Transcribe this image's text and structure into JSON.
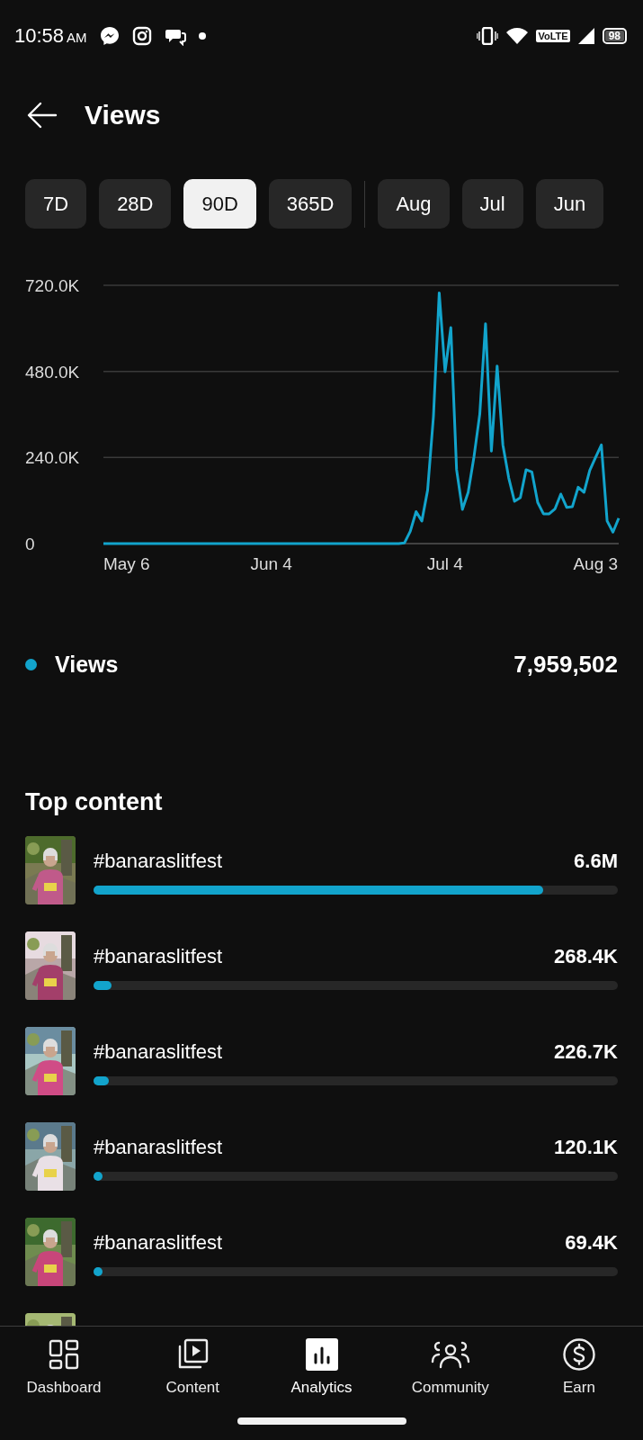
{
  "status_bar": {
    "time": "10:58",
    "ampm": "AM",
    "network": "VoLTE",
    "battery": "98"
  },
  "header": {
    "title": "Views"
  },
  "ranges": [
    {
      "label": "7D",
      "selected": false
    },
    {
      "label": "28D",
      "selected": false
    },
    {
      "label": "90D",
      "selected": true
    },
    {
      "label": "365D",
      "selected": false
    }
  ],
  "months": [
    {
      "label": "Aug",
      "selected": false
    },
    {
      "label": "Jul",
      "selected": false
    },
    {
      "label": "Jun",
      "selected": false
    }
  ],
  "chart_data": {
    "type": "line",
    "categories": [
      null,
      null,
      null,
      null,
      "May 6",
      null,
      null,
      null,
      null,
      null,
      null,
      null,
      null,
      null,
      null,
      null,
      null,
      null,
      null,
      null,
      null,
      null,
      null,
      null,
      null,
      null,
      null,
      null,
      null,
      "Jun 4",
      null,
      null,
      null,
      null,
      null,
      null,
      null,
      null,
      null,
      null,
      null,
      null,
      null,
      null,
      null,
      null,
      null,
      null,
      null,
      null,
      null,
      null,
      null,
      null,
      null,
      null,
      null,
      null,
      null,
      "Jul 4",
      null,
      null,
      null,
      null,
      null,
      null,
      null,
      null,
      null,
      null,
      null,
      null,
      null,
      null,
      null,
      null,
      null,
      null,
      null,
      null,
      null,
      null,
      null,
      null,
      null,
      "Aug 3",
      null,
      null,
      null,
      null
    ],
    "series": [
      {
        "name": "Views",
        "color": "#12a4cc",
        "values": [
          0,
          0,
          0,
          0,
          0,
          0,
          0,
          0,
          0,
          0,
          0,
          0,
          0,
          0,
          0,
          0,
          0,
          0,
          0,
          0,
          0,
          0,
          0,
          0,
          0,
          0,
          0,
          0,
          0,
          0,
          0,
          0,
          0,
          0,
          0,
          0,
          0,
          0,
          0,
          0,
          0,
          0,
          0,
          0,
          0,
          0,
          0,
          0,
          0,
          0,
          0,
          0,
          2000,
          34000,
          89000,
          63000,
          149000,
          355000,
          699000,
          479000,
          602000,
          206000,
          95000,
          143000,
          241000,
          361000,
          613000,
          258000,
          495000,
          275000,
          183000,
          118000,
          128000,
          206000,
          200000,
          115000,
          83000,
          83000,
          97000,
          138000,
          101000,
          103000,
          157000,
          143000,
          204000,
          240000,
          275000,
          63000,
          32000,
          71000
        ]
      }
    ],
    "yticks": [
      {
        "value": 0,
        "label": "0"
      },
      {
        "value": 240000,
        "label": "240.0K"
      },
      {
        "value": 480000,
        "label": "480.0K"
      },
      {
        "value": 720000,
        "label": "720.0K"
      }
    ],
    "ylim": [
      0,
      720000
    ]
  },
  "legend": {
    "total": "7,959,502"
  },
  "top_content": {
    "title": "Top content",
    "rows": [
      {
        "title": "#banaraslitfest",
        "views": "6.6M",
        "level": 0.857
      },
      {
        "title": "#banaraslitfest",
        "views": "268.4K",
        "level": 0.035
      },
      {
        "title": "#banaraslitfest",
        "views": "226.7K",
        "level": 0.029
      },
      {
        "title": "#banaraslitfest",
        "views": "120.1K",
        "level": 0.016
      },
      {
        "title": "#banaraslitfest",
        "views": "69.4K",
        "level": 0.01
      }
    ]
  },
  "nav": [
    {
      "label": "Dashboard",
      "selected": false
    },
    {
      "label": "Content",
      "selected": false
    },
    {
      "label": "Analytics",
      "selected": true
    },
    {
      "label": "Community",
      "selected": false
    },
    {
      "label": "Earn",
      "selected": false
    }
  ]
}
